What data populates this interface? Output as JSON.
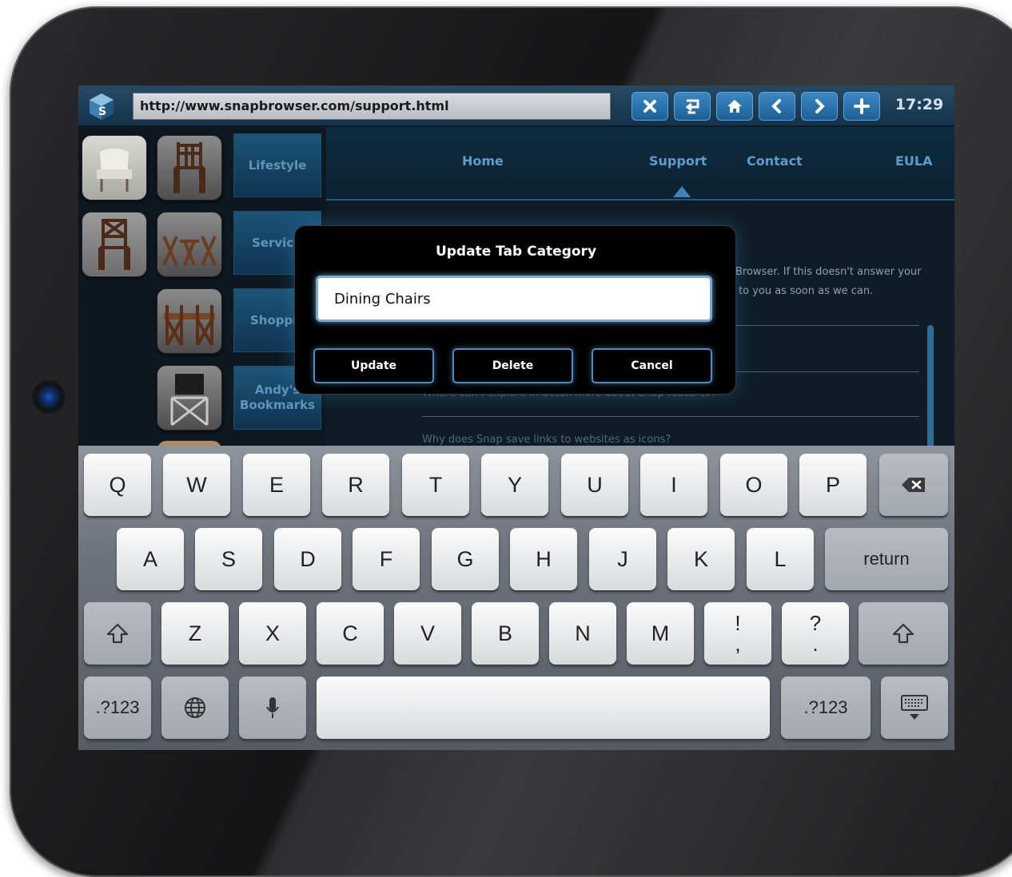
{
  "browser": {
    "url": "http://www.snapbrowser.com/support.html",
    "clock": "17:29",
    "toolbar_icons": [
      "close-icon",
      "tabs-icon",
      "home-icon",
      "back-icon",
      "forward-icon",
      "add-icon"
    ]
  },
  "categories": [
    {
      "label": "Lifestyle"
    },
    {
      "label": "Service"
    },
    {
      "label": "Shoppir"
    },
    {
      "label": "Andy's Bookmarks"
    }
  ],
  "nav": {
    "items": [
      "Home",
      "Support",
      "Contact",
      "EULA"
    ],
    "active": "Support"
  },
  "content": {
    "line1": "Browser. If this doesn't answer your",
    "line2": "to you as soon as we can.",
    "faq_partial": "Where can I explore in detail more about Snap features?",
    "faq_bottom": "Why does Snap save links to websites as icons?"
  },
  "dialog": {
    "title": "Update Tab Category",
    "input_value": "Dining Chairs",
    "buttons": [
      "Update",
      "Delete",
      "Cancel"
    ]
  },
  "keyboard": {
    "row1": [
      "Q",
      "W",
      "E",
      "R",
      "T",
      "Y",
      "U",
      "I",
      "O",
      "P"
    ],
    "row2": [
      "A",
      "S",
      "D",
      "F",
      "G",
      "H",
      "J",
      "K",
      "L"
    ],
    "return_label": "return",
    "row3": [
      "Z",
      "X",
      "C",
      "V",
      "B",
      "N",
      "M"
    ],
    "punct1": {
      "top": "!",
      "bottom": ","
    },
    "punct2": {
      "top": "?",
      "bottom": "."
    },
    "numbers_label": ".?123"
  }
}
